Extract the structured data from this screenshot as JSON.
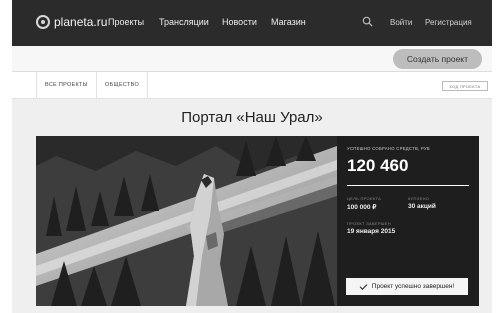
{
  "header": {
    "logo_text": "planeta.ru",
    "nav": [
      {
        "label": "Проекты"
      },
      {
        "label": "Трансляции"
      },
      {
        "label": "Новости"
      },
      {
        "label": "Магазин"
      }
    ],
    "login_label": "Войти",
    "register_label": "Регистрация"
  },
  "actions": {
    "create_project_label": "Создать проект"
  },
  "tabs": [
    {
      "label": "ВСЕ ПРОЕКТЫ"
    },
    {
      "label": "ОБЩЕСТВО"
    }
  ],
  "code_button_label": "КОД ПРОЕКТА",
  "project": {
    "title": "Портал «Наш Урал»",
    "raised_label": "УСПЕШНО СОБРАНО СРЕДСТВ, РУБ",
    "raised_value": "120 460",
    "progress": 1.0,
    "goal_label": "ЦЕЛЬ ПРОЕКТА",
    "goal_value": "100 000 ₽",
    "bought_label": "КУПЛЕНО",
    "bought_value": "30 акций",
    "finished_label": "ПРОЕКТ ЗАВЕРШЕН",
    "finished_date": "19 января 2015",
    "status_button_label": "Проект успешно завершен!"
  },
  "colors": {
    "topbar": "#2b2b2b",
    "panel": "#1e1e1e",
    "button_grey": "#bdbdbd"
  }
}
